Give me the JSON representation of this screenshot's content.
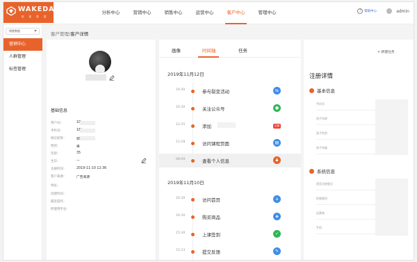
{
  "brand": {
    "name": "WAKEDATA",
    "subtitle": "唯 客 数 据"
  },
  "nav": {
    "items": [
      "分析中心",
      "营销中心",
      "销售中心",
      "运营中心",
      "客户中心",
      "管理中心"
    ],
    "active_index": 4
  },
  "topbar": {
    "help_label": "帮助中心",
    "user": "admin"
  },
  "sidebar": {
    "switcher": "销售数据",
    "items": [
      "营销中心",
      "人群管理",
      "标签管理"
    ],
    "active_index": 0
  },
  "breadcrumb": {
    "parent": "客户管理/",
    "current": "客户详情"
  },
  "profile": {
    "section_title": "基础信息",
    "rows": [
      {
        "label": "用户ID：",
        "value": "1C"
      },
      {
        "label": "手机号：",
        "value": "18("
      },
      {
        "label": "微信昵称：",
        "value": "郭"
      },
      {
        "label": "性别：",
        "value": "男"
      },
      {
        "label": "年龄：",
        "value": "35"
      },
      {
        "label": "生日：",
        "value": "—"
      },
      {
        "label": "注册时间：",
        "value": "2019-11-10 12:36"
      },
      {
        "label": "客户来源：",
        "value": "广告来源"
      },
      {
        "label": "地址：",
        "value": ""
      },
      {
        "label": "创建时间：",
        "value": ""
      },
      {
        "label": "最近操作：",
        "value": ""
      },
      {
        "label": "所使用平台：",
        "value": ""
      }
    ]
  },
  "tabs": {
    "items": [
      "画像",
      "时间轴",
      "任务"
    ],
    "active_index": 1,
    "new_task": "+ 新建任务"
  },
  "timeline": [
    {
      "date": "2019年11月12日",
      "events": [
        {
          "time": "16:40",
          "title": "参与裂变活动",
          "icon": "share-icon",
          "color": "#3d8ee8"
        },
        {
          "time": "16:30",
          "title": "关注公众号",
          "icon": "wechat-icon",
          "color": "#2fb755"
        },
        {
          "time": "12:25",
          "title": "添加",
          "icon": "red-tag-icon",
          "color": "#e8453c",
          "tag": "企微"
        },
        {
          "time": "11:28",
          "title": "访问课程页面",
          "icon": "book-icon",
          "color": "#3d8ee8"
        },
        {
          "time": "08:09",
          "title": "查看个人信息",
          "icon": "user-icon",
          "color": "#e8632b"
        }
      ]
    },
    {
      "date": "2019年11月10日",
      "events": [
        {
          "time": "20:30",
          "title": "访问首页",
          "icon": "home-icon",
          "color": "#3d8ee8"
        },
        {
          "time": "16:30",
          "title": "购买商品",
          "icon": "cart-icon",
          "color": "#3d8ee8"
        },
        {
          "time": "15:30",
          "title": "上课签到",
          "icon": "checkin-icon",
          "color": "#2fb755"
        },
        {
          "time": "15:23",
          "title": "提交反馈",
          "icon": "feedback-icon",
          "color": "#3d8ee8"
        }
      ]
    }
  ],
  "registration": {
    "title": "注册详情",
    "sections": [
      {
        "title": "基本信息",
        "fields": [
          "手机号",
          "孩子年龄",
          "孩子性别",
          "孩子年级"
        ]
      },
      {
        "title": "系统信息",
        "fields": [
          "是否注册登记",
          "招商顾问",
          "运营商",
          "手机"
        ]
      }
    ]
  }
}
